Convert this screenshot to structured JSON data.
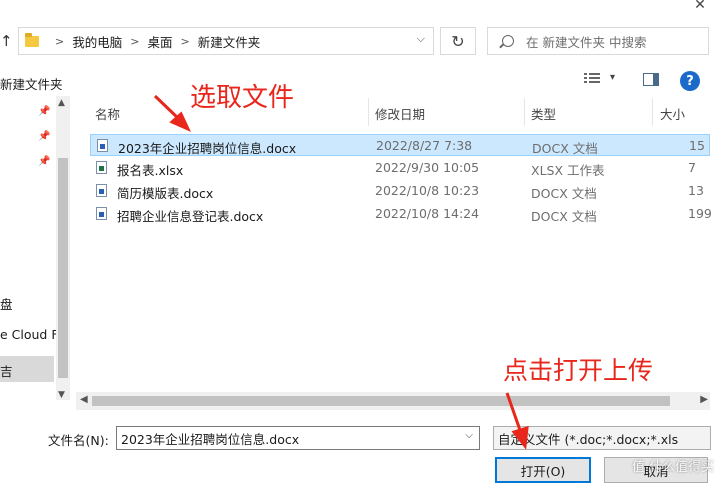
{
  "window": {
    "close_glyph": "✕"
  },
  "address_bar": {
    "up_glyph": "↑",
    "breadcrumbs": [
      "我的电脑",
      "桌面",
      "新建文件夹"
    ],
    "dropdown_glyph": "⌵",
    "refresh_glyph": "↻"
  },
  "search": {
    "placeholder": "在 新建文件夹 中搜索"
  },
  "toolbar": {
    "new_folder_label": "新建文件夹",
    "view_dropdown_glyph": "▾",
    "help_label": "?"
  },
  "nav_pane": {
    "labels": [
      "盘",
      "e Cloud F",
      "吉"
    ]
  },
  "file_list": {
    "columns": {
      "name": "名称",
      "date": "修改日期",
      "type": "类型",
      "size": "大小"
    },
    "rows": [
      {
        "name": "2023年企业招聘岗位信息.docx",
        "date": "2022/8/27 7:38",
        "type": "DOCX 文档",
        "size": "15",
        "icon": "word-doc-icon",
        "selected": true
      },
      {
        "name": "报名表.xlsx",
        "date": "2022/9/30 10:05",
        "type": "XLSX 工作表",
        "size": "7",
        "icon": "excel-doc-icon",
        "selected": false
      },
      {
        "name": "简历模版表.docx",
        "date": "2022/10/8 10:23",
        "type": "DOCX 文档",
        "size": "13",
        "icon": "word-doc-icon",
        "selected": false
      },
      {
        "name": "招聘企业信息登记表.docx",
        "date": "2022/10/8 14:24",
        "type": "DOCX 文档",
        "size": "199",
        "icon": "word-doc-icon",
        "selected": false
      }
    ]
  },
  "footer": {
    "filename_label": "文件名(N):",
    "filename_value": "2023年企业招聘岗位信息.docx",
    "filetype_value": "自定义文件 (*.doc;*.docx;*.xls",
    "open_label": "打开(O)",
    "cancel_label": "取消"
  },
  "annotations": {
    "select_file": "选取文件",
    "click_open": "点击打开上传",
    "watermark": "值 什么值得买"
  },
  "colors": {
    "annotation": "#e8261b",
    "selection": "#cce8ff",
    "accent": "#0078d7"
  }
}
